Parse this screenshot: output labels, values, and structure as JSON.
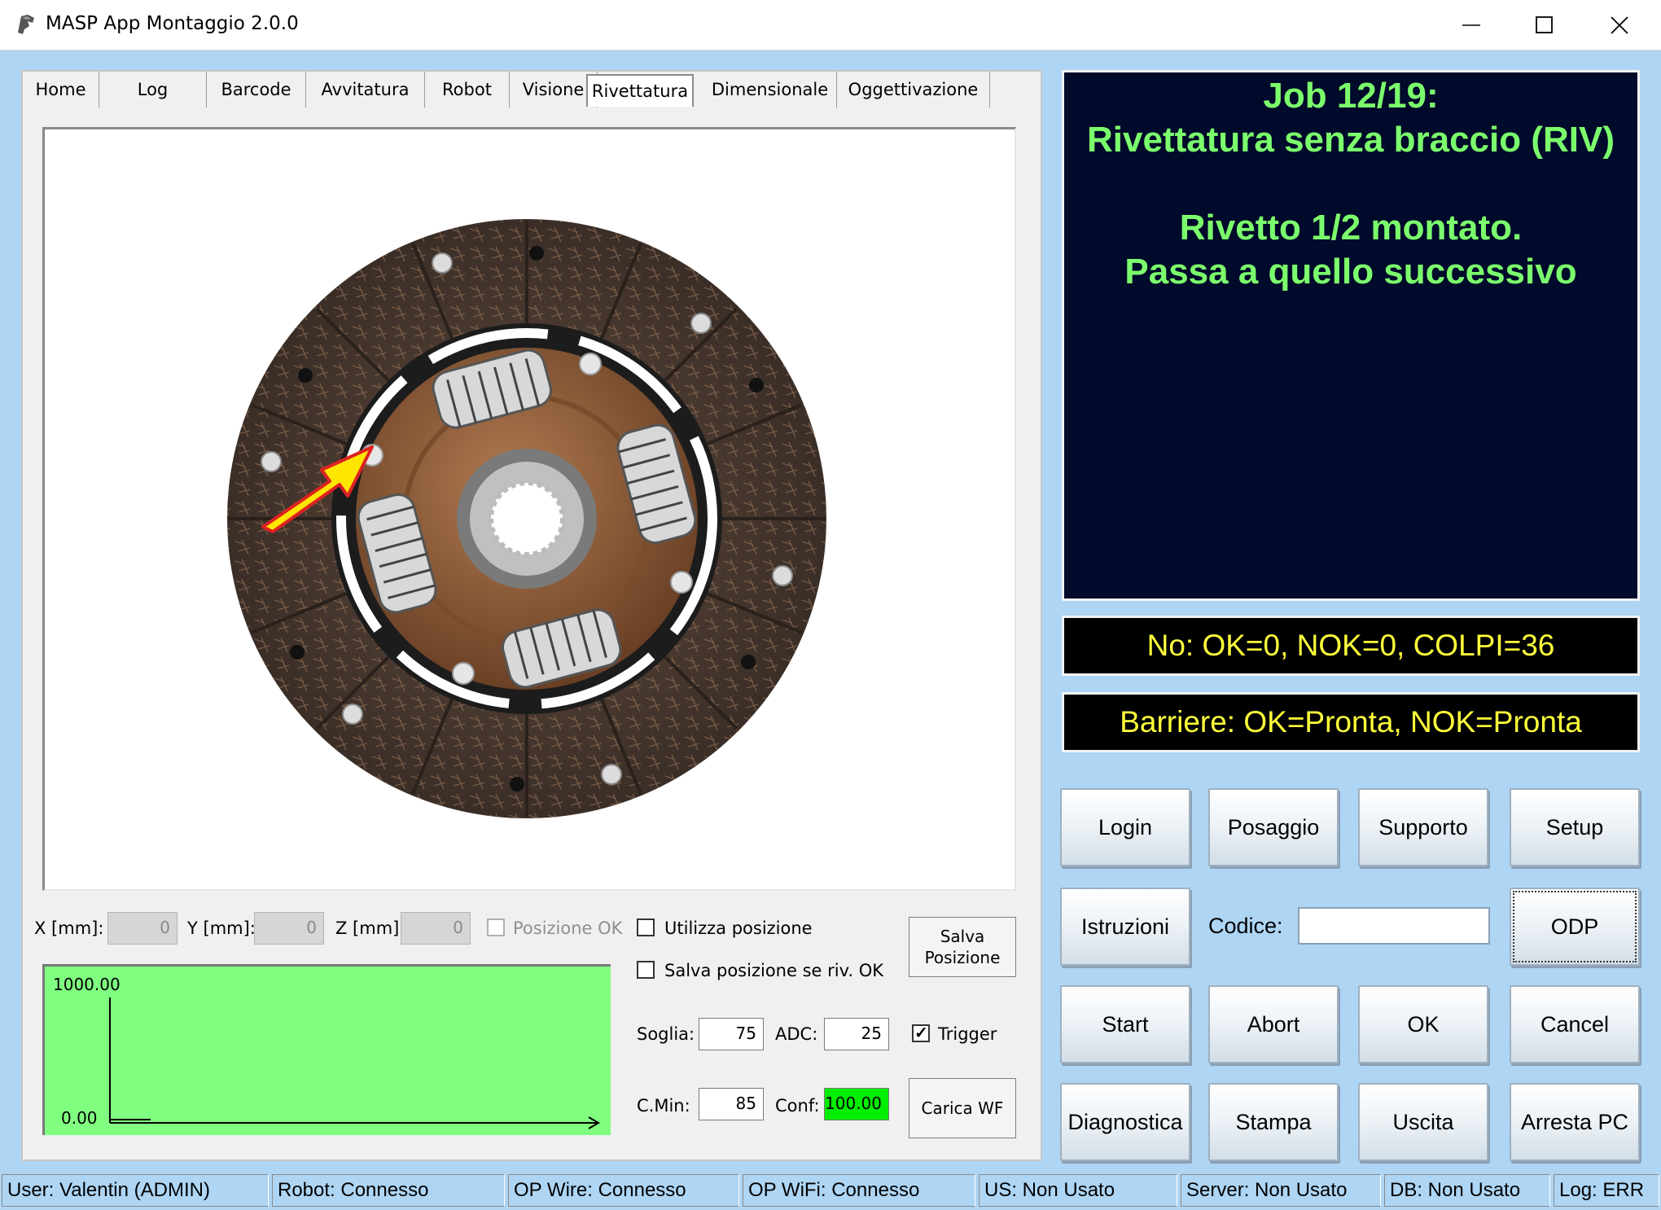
{
  "window": {
    "title": "MASP App Montaggio 2.0.0"
  },
  "tabs": [
    {
      "label": "Home"
    },
    {
      "label": "Log"
    },
    {
      "label": "Barcode"
    },
    {
      "label": "Avvitatura"
    },
    {
      "label": "Robot"
    },
    {
      "label": "Visione"
    },
    {
      "label": "Rivettatura",
      "active": true
    },
    {
      "label": "Dimensionale"
    },
    {
      "label": "Oggettivazione"
    }
  ],
  "rivettatura": {
    "x_label": "X [mm]:",
    "x_value": "0",
    "y_label": "Y [mm]:",
    "y_value": "0",
    "z_label": "Z [mm]:",
    "z_value": "0",
    "posizione_ok_label": "Posizione OK",
    "utilizza_posizione_label": "Utilizza posizione",
    "salva_posizione_riv_label": "Salva posizione se riv. OK",
    "salva_posizione_button_line1": "Salva",
    "salva_posizione_button_line2": "Posizione",
    "soglia_label": "Soglia:",
    "soglia_value": "75",
    "adc_label": "ADC:",
    "adc_value": "25",
    "trigger_label": "Trigger",
    "cmin_label": "C.Min:",
    "cmin_value": "85",
    "conf_label": "Conf:",
    "conf_value": "100.00",
    "carica_wf_label": "Carica WF",
    "graph_max": "1000.00",
    "graph_min": "0.00"
  },
  "checkboxes": {
    "posizione_ok": false,
    "utilizza_posizione": false,
    "salva_posizione_riv": false,
    "trigger": true
  },
  "job": {
    "line1": "Job 12/19:",
    "line2": "Rivettatura senza braccio (RIV)",
    "line3": "Rivetto 1/2 montato.",
    "line4": "Passa a quello successivo"
  },
  "counters": "No: OK=0, NOK=0, COLPI=36",
  "barriers": "Barriere: OK=Pronta, NOK=Pronta",
  "buttons": {
    "login": "Login",
    "posaggio": "Posaggio",
    "supporto": "Supporto",
    "setup": "Setup",
    "istruzioni": "Istruzioni",
    "codice_label": "Codice:",
    "codice_value": "",
    "odp": "ODP",
    "start": "Start",
    "abort": "Abort",
    "ok": "OK",
    "cancel": "Cancel",
    "diagnostica": "Diagnostica",
    "stampa": "Stampa",
    "uscita": "Uscita",
    "arresta_pc": "Arresta PC"
  },
  "statusbar": {
    "user": "User: Valentin (ADMIN)",
    "robot": "Robot: Connesso",
    "op_wire": "OP Wire: Connesso",
    "op_wifi": "OP WiFi: Connesso",
    "us": "US: Non Usato",
    "server": "Server: Non Usato",
    "db": "DB: Non Usato",
    "log": "Log: ERR"
  },
  "colors": {
    "window_bg": "#aed5f4",
    "job_panel_bg": "#000a2a",
    "job_text": "#7cff6c",
    "status_text": "#ffff3a",
    "graph_bg": "#80ff80",
    "conf_bg": "#00ee00"
  }
}
